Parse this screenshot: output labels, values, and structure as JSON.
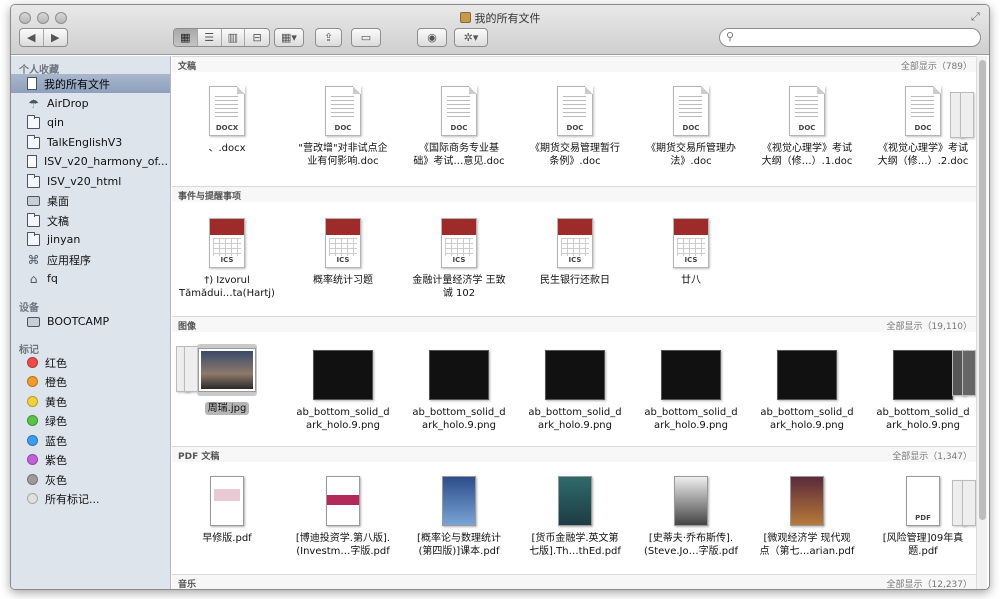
{
  "window": {
    "title": "我的所有文件"
  },
  "toolbar": {
    "back_icon": "◀",
    "forward_icon": "▶",
    "view_icons": [
      "▦",
      "☰",
      "▥",
      "⊟"
    ],
    "arrange_icon": "▦▾",
    "share_icon": "⇪",
    "tag_icon": "▭",
    "quicklook_icon": "◉",
    "action_icon": "✲▾",
    "search_placeholder": ""
  },
  "sidebar": {
    "favorites_header": "个人收藏",
    "favorites": [
      {
        "label": "我的所有文件",
        "icon": "all-files-icon"
      },
      {
        "label": "AirDrop",
        "icon": "airdrop-icon"
      },
      {
        "label": "qin",
        "icon": "folder-icon"
      },
      {
        "label": "TalkEnglishV3",
        "icon": "folder-icon"
      },
      {
        "label": "ISV_v20_harmony_of...",
        "icon": "document-icon"
      },
      {
        "label": "ISV_v20_html",
        "icon": "folder-icon"
      },
      {
        "label": "桌面",
        "icon": "desktop-icon"
      },
      {
        "label": "文稿",
        "icon": "folder-icon"
      },
      {
        "label": "jinyan",
        "icon": "folder-icon"
      },
      {
        "label": "应用程序",
        "icon": "applications-icon"
      },
      {
        "label": "fq",
        "icon": "home-icon"
      }
    ],
    "devices_header": "设备",
    "devices": [
      {
        "label": "BOOTCAMP",
        "icon": "drive-icon"
      }
    ],
    "tags_header": "标记",
    "tags": [
      {
        "label": "红色",
        "color": "#ee4b4b"
      },
      {
        "label": "橙色",
        "color": "#f39a2b"
      },
      {
        "label": "黄色",
        "color": "#f2d23a"
      },
      {
        "label": "绿色",
        "color": "#5ac34a"
      },
      {
        "label": "蓝色",
        "color": "#3d9bf0"
      },
      {
        "label": "紫色",
        "color": "#c061d9"
      },
      {
        "label": "灰色",
        "color": "#9b9b9b"
      },
      {
        "label": "所有标记...",
        "color": "#e0e0e0"
      }
    ]
  },
  "sections": {
    "docs": {
      "name": "文稿",
      "show_all": "全部显示（789）",
      "items": [
        {
          "l1": "、.docx",
          "l2": "",
          "tag": "DOCX"
        },
        {
          "l1": "\"营改增\"对非试点企",
          "l2": "业有何影响.doc",
          "tag": "DOC"
        },
        {
          "l1": "《国际商务专业基",
          "l2": "础》考试…意见.doc",
          "tag": "DOC"
        },
        {
          "l1": "《期货交易管理暂行",
          "l2": "条例》.doc",
          "tag": "DOC"
        },
        {
          "l1": "《期货交易所管理办",
          "l2": "法》.doc",
          "tag": "DOC"
        },
        {
          "l1": "《视觉心理学》考试",
          "l2": "大纲（修…）.1.doc",
          "tag": "DOC"
        },
        {
          "l1": "《视觉心理学》考试",
          "l2": "大纲（修…）.2.doc",
          "tag": "DOC"
        }
      ]
    },
    "events": {
      "name": "事件与提醒事项",
      "items": [
        {
          "l1": "†) Izvorul",
          "l2": "Tămădui…ta(Hartj)",
          "tag": "ICS"
        },
        {
          "l1": "概率统计习题",
          "l2": "",
          "tag": "ICS"
        },
        {
          "l1": "金融计量经济学 王致",
          "l2": "诚 102",
          "tag": "ICS"
        },
        {
          "l1": "民生银行还款日",
          "l2": "",
          "tag": "ICS"
        },
        {
          "l1": "廿八",
          "l2": "",
          "tag": "ICS"
        }
      ]
    },
    "images": {
      "name": "图像",
      "show_all": "全部显示（19,110）",
      "items": [
        {
          "l1": "周瑞.jpg",
          "l2": ""
        },
        {
          "l1": "ab_bottom_solid_d",
          "l2": "ark_holo.9.png"
        },
        {
          "l1": "ab_bottom_solid_d",
          "l2": "ark_holo.9.png"
        },
        {
          "l1": "ab_bottom_solid_d",
          "l2": "ark_holo.9.png"
        },
        {
          "l1": "ab_bottom_solid_d",
          "l2": "ark_holo.9.png"
        },
        {
          "l1": "ab_bottom_solid_d",
          "l2": "ark_holo.9.png"
        },
        {
          "l1": "ab_bottom_solid_d",
          "l2": "ark_holo.9.png"
        }
      ]
    },
    "pdfs": {
      "name": "PDF 文稿",
      "show_all": "全部显示（1,347）",
      "items": [
        {
          "l1": "早修版.pdf",
          "l2": ""
        },
        {
          "l1": "[博迪投资学.第八版].",
          "l2": "(Investm…字版.pdf"
        },
        {
          "l1": "[概率论与数理统计",
          "l2": "(第四版)]课本.pdf"
        },
        {
          "l1": "[货币金融学.英文第",
          "l2": "七版].Th…thEd.pdf"
        },
        {
          "l1": "[史蒂夫·乔布斯传].",
          "l2": "(Steve.Jo…字版.pdf"
        },
        {
          "l1": "[微观经济学 现代观",
          "l2": "点（第七…arian.pdf"
        },
        {
          "l1": "[风险管理]09年真",
          "l2": "题.pdf"
        }
      ]
    },
    "music": {
      "name": "音乐",
      "show_all": "全部显示（12,237）"
    }
  }
}
